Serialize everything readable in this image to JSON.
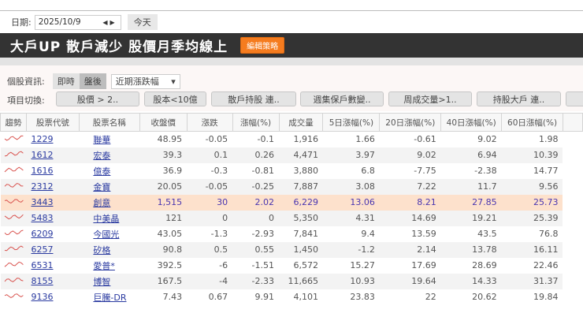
{
  "date": {
    "label": "日期:",
    "value": "2025/10/9",
    "today": "今天"
  },
  "title": "大戶UP 散戶減少  股價月季均線上",
  "edit_button": "編輯策略",
  "info": {
    "label": "個股資訊:",
    "realtime": "即時",
    "after_hours": "盤後",
    "select": "近期漲跌幅",
    "caret": "▾"
  },
  "filters": {
    "label": "項目切換:",
    "buttons": [
      "股價 > 2..",
      "股本<10億",
      "散戶持股 連..",
      "週集保戶數變..",
      "周成交量>1..",
      "持股大戶 連..",
      ""
    ]
  },
  "columns": [
    "趨勢",
    "股票代號",
    "股票名稱",
    "收盤價",
    "漲跌",
    "漲幅(%)",
    "成交量",
    "5日漲幅(%)",
    "20日漲幅(%)",
    "40日漲幅(%)",
    "60日漲幅(%)"
  ],
  "rows": [
    [
      "1229",
      "聯華",
      "48.95",
      "-0.05",
      "-0.1",
      "1,916",
      "1.66",
      "-0.61",
      "9.02",
      "1.98"
    ],
    [
      "1612",
      "宏泰",
      "39.3",
      "0.1",
      "0.26",
      "4,471",
      "3.97",
      "9.02",
      "6.94",
      "10.39"
    ],
    [
      "1616",
      "億泰",
      "36.9",
      "-0.3",
      "-0.81",
      "3,880",
      "6.8",
      "-7.75",
      "-2.38",
      "14.77"
    ],
    [
      "2312",
      "金寶",
      "20.05",
      "-0.05",
      "-0.25",
      "7,887",
      "3.08",
      "7.22",
      "11.7",
      "9.56"
    ],
    [
      "3443",
      "創意",
      "1,515",
      "30",
      "2.02",
      "6,229",
      "13.06",
      "8.21",
      "27.85",
      "25.73"
    ],
    [
      "5483",
      "中美晶",
      "121",
      "0",
      "0",
      "5,350",
      "4.31",
      "14.69",
      "19.21",
      "25.39"
    ],
    [
      "6209",
      "今國光",
      "43.05",
      "-1.3",
      "-2.93",
      "7,841",
      "9.4",
      "13.59",
      "43.5",
      "76.8"
    ],
    [
      "6257",
      "矽格",
      "90.8",
      "0.5",
      "0.55",
      "1,450",
      "-1.2",
      "2.14",
      "13.78",
      "16.11"
    ],
    [
      "6531",
      "愛普*",
      "392.5",
      "-6",
      "-1.51",
      "6,572",
      "15.27",
      "17.69",
      "28.69",
      "22.46"
    ],
    [
      "8155",
      "博智",
      "167.5",
      "-4",
      "-2.33",
      "11,665",
      "10.93",
      "19.64",
      "14.33",
      "31.37"
    ],
    [
      "9136",
      "巨騰-DR",
      "7.43",
      "0.67",
      "9.91",
      "4,101",
      "23.83",
      "22",
      "20.62",
      "19.84"
    ]
  ],
  "highlight_row": 4,
  "colors": {
    "accent": "#f57c1f",
    "highlight": "#fde1cc",
    "spark": "#d9534f"
  }
}
